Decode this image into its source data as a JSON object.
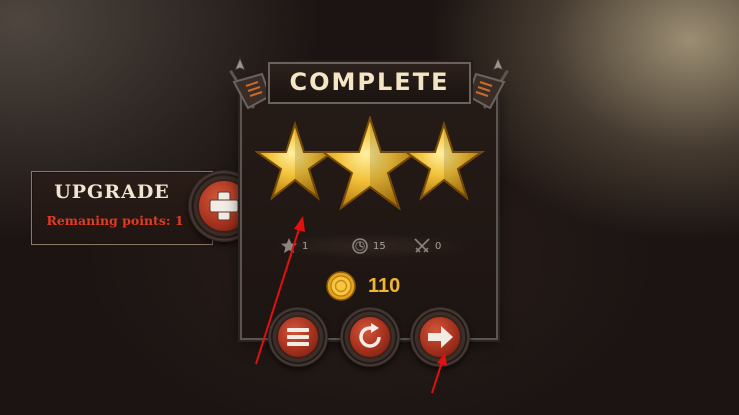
{
  "upgrade": {
    "title": "UPGRADE",
    "points_text": "Remaning points: 1",
    "add_icon": "plus-icon"
  },
  "result": {
    "title": "COMPLETE",
    "stars_earned": 3,
    "stars_total": 3,
    "stats": [
      {
        "icon": "star-icon",
        "value": "1"
      },
      {
        "icon": "clock-icon",
        "value": "15"
      },
      {
        "icon": "crossed-swords-icon",
        "value": "0"
      }
    ],
    "coins": {
      "icon": "gold-coin-icon",
      "amount": "110"
    }
  },
  "actions": [
    {
      "name": "menu-button",
      "icon": "menu-icon"
    },
    {
      "name": "restart-button",
      "icon": "restart-icon"
    },
    {
      "name": "next-button",
      "icon": "arrow-right-icon"
    }
  ],
  "colors": {
    "accent_red": "#a8331f",
    "points_red": "#e33a22",
    "gold": "#f0b531",
    "title_cream": "#f4e6c4",
    "annotation_arrow": "#e31010"
  }
}
